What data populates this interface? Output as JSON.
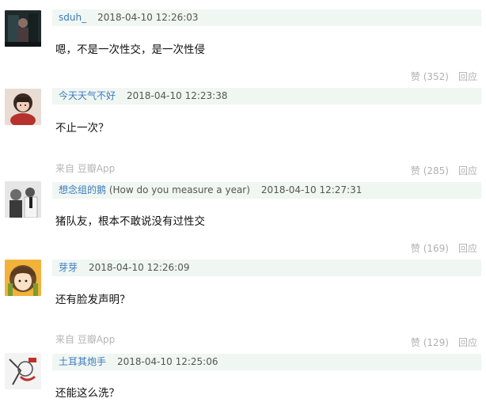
{
  "comments": [
    {
      "author": "sduh_",
      "author_extra": "",
      "time": "2018-04-10 12:26:03",
      "content": "嗯，不是一次性交，是一次性侵",
      "source": "",
      "likes": "赞 (352)",
      "reply": "回应"
    },
    {
      "author": "今天天气不好",
      "author_extra": "",
      "time": "2018-04-10 12:23:38",
      "content": "不止一次？",
      "source": "来自 豆瓣App",
      "likes": "赞 (285)",
      "reply": "回应"
    },
    {
      "author": "想念组的鹅",
      "author_extra": " (How do you measure a year)",
      "time": "2018-04-10 12:27:31",
      "content": "猪队友，根本不敢说没有过性交",
      "source": "",
      "likes": "赞 (169)",
      "reply": "回应"
    },
    {
      "author": "芽芽",
      "author_extra": "",
      "time": "2018-04-10 12:26:09",
      "content": "还有脸发声明？",
      "source": "来自 豆瓣App",
      "likes": "赞 (129)",
      "reply": "回应"
    },
    {
      "author": "土耳其炮手",
      "author_extra": "",
      "time": "2018-04-10 12:25:06",
      "content": "还能这么洗？",
      "source": "",
      "likes": "",
      "reply": ""
    }
  ],
  "colors": {
    "meta_bg": "#f0f6f2",
    "author_link": "#3a7bbd",
    "muted": "#b0b0b0"
  }
}
